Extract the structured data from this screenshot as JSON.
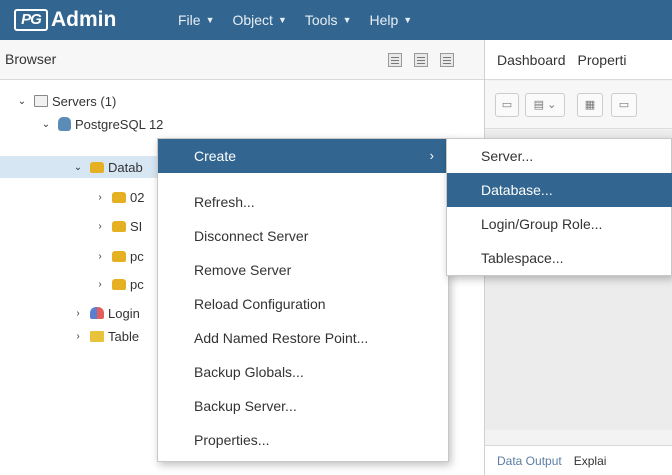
{
  "app": {
    "logo_pg": "PG",
    "logo_text": "Admin"
  },
  "menubar": [
    {
      "label": "File"
    },
    {
      "label": "Object"
    },
    {
      "label": "Tools"
    },
    {
      "label": "Help"
    }
  ],
  "browser": {
    "title": "Browser",
    "tree": [
      {
        "label": "Servers (1)",
        "toggle": "⌄"
      },
      {
        "label": "PostgreSQL 12",
        "toggle": "⌄"
      },
      {
        "label": "Datab",
        "toggle": "⌄"
      },
      {
        "label": "02",
        "toggle": "›"
      },
      {
        "label": "SI",
        "toggle": "›"
      },
      {
        "label": "pc",
        "toggle": "›"
      },
      {
        "label": "pc",
        "toggle": "›"
      },
      {
        "label": "Login",
        "toggle": "›"
      },
      {
        "label": "Table",
        "toggle": "›"
      }
    ]
  },
  "right_panel": {
    "tabs": [
      "Dashboard",
      "Properti"
    ],
    "bottom_tabs": [
      "Data Output",
      "Explai"
    ]
  },
  "context_menu": {
    "items": [
      {
        "label": "Create",
        "arrow": "›"
      },
      {
        "label": "Refresh..."
      },
      {
        "label": "Disconnect Server"
      },
      {
        "label": "Remove Server"
      },
      {
        "label": "Reload Configuration"
      },
      {
        "label": "Add Named Restore Point..."
      },
      {
        "label": "Backup Globals..."
      },
      {
        "label": "Backup Server..."
      },
      {
        "label": "Properties..."
      }
    ]
  },
  "submenu": {
    "items": [
      {
        "label": "Server..."
      },
      {
        "label": "Database..."
      },
      {
        "label": "Login/Group Role..."
      },
      {
        "label": "Tablespace..."
      }
    ]
  },
  "colors": {
    "brand": "#326690",
    "selection": "#d6e6f3"
  }
}
